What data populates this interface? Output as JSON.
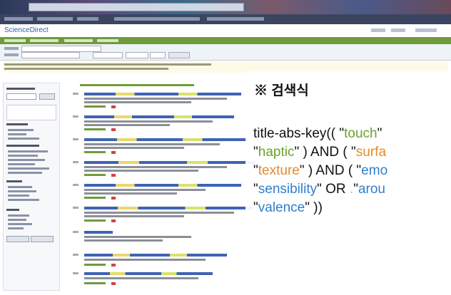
{
  "browser": {
    "label": "browser-window"
  },
  "site": {
    "logo": "ScienceDirect"
  },
  "overlay": {
    "title": "※ 검색식",
    "lines": [
      {
        "parts": [
          "title-abs-key(( \"",
          "touch",
          "\""
        ]
      },
      {
        "parts": [
          "\"",
          "haptic",
          "\" ) AND ( \"",
          "surfa"
        ]
      },
      {
        "parts": [
          "\"",
          "texture",
          "\" ) AND ( \"",
          "emo"
        ]
      },
      {
        "parts": [
          "\"",
          "sensibility",
          "\"  OR  ",
          ".",
          "\"",
          "arou"
        ]
      },
      {
        "parts": [
          "\"",
          "valence",
          "\" ))"
        ]
      }
    ]
  },
  "colors": {
    "green_keyword": "#6aa22a",
    "orange_keyword": "#e88a2a",
    "blue_keyword": "#2f7fcf"
  }
}
